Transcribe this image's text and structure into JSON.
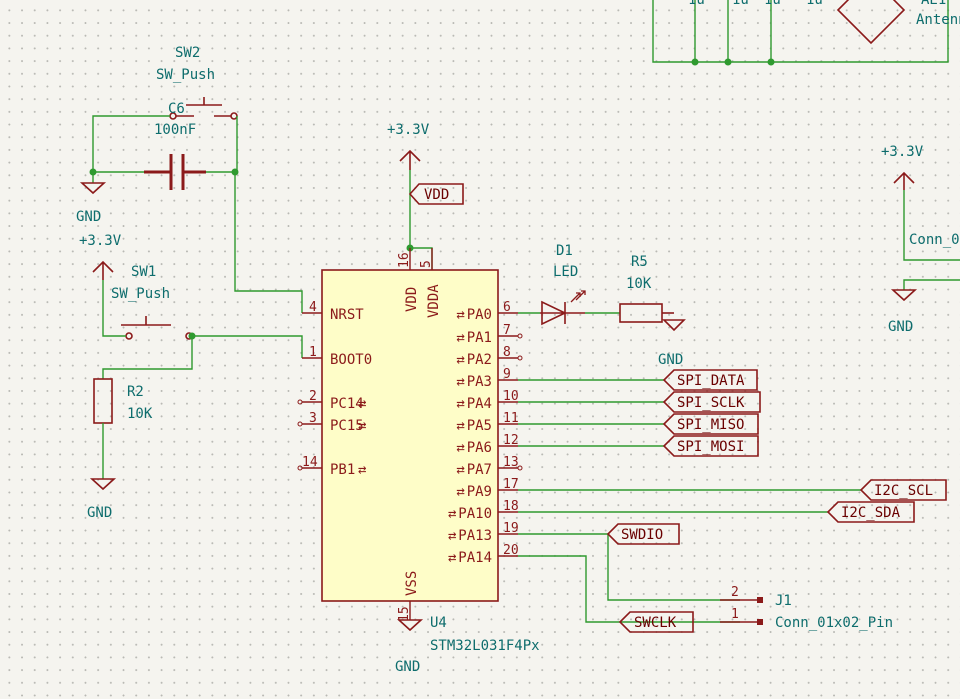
{
  "power": {
    "v33": "+3.3V",
    "gnd": "GND"
  },
  "components": {
    "sw2": {
      "ref": "SW2",
      "value": "SW_Push"
    },
    "c6": {
      "ref": "C6",
      "value": "100nF"
    },
    "sw1": {
      "ref": "SW1",
      "value": "SW_Push"
    },
    "r2": {
      "ref": "R2",
      "value": "10K"
    },
    "d1": {
      "ref": "D1",
      "value": "LED"
    },
    "r5": {
      "ref": "R5",
      "value": "10K"
    },
    "u4": {
      "ref": "U4",
      "value": "STM32L031F4Px"
    },
    "j1": {
      "ref": "J1",
      "value": "Conn_01x02_Pin"
    },
    "ae1_partial": {
      "ref": "AE1",
      "value": "Antenna"
    },
    "conn_partial": {
      "value": "Conn_0"
    }
  },
  "partial_top_labels": [
    "1u",
    "1u",
    "1u",
    "1u"
  ],
  "ic_pins_left": [
    {
      "num": "4",
      "name": "NRST"
    },
    {
      "num": "1",
      "name": "BOOT0"
    },
    {
      "num": "2",
      "name": "PC14"
    },
    {
      "num": "3",
      "name": "PC15"
    },
    {
      "num": "14",
      "name": "PB1"
    }
  ],
  "ic_pins_right": [
    {
      "num": "6",
      "name": "PA0"
    },
    {
      "num": "7",
      "name": "PA1"
    },
    {
      "num": "8",
      "name": "PA2"
    },
    {
      "num": "9",
      "name": "PA3"
    },
    {
      "num": "10",
      "name": "PA4"
    },
    {
      "num": "11",
      "name": "PA5"
    },
    {
      "num": "12",
      "name": "PA6"
    },
    {
      "num": "13",
      "name": "PA7"
    },
    {
      "num": "17",
      "name": "PA9"
    },
    {
      "num": "18",
      "name": "PA10"
    },
    {
      "num": "19",
      "name": "PA13"
    },
    {
      "num": "20",
      "name": "PA14"
    }
  ],
  "ic_pins_top": [
    {
      "num": "16",
      "name": "VDD"
    },
    {
      "num": "5",
      "name": "VDDA"
    }
  ],
  "ic_pins_bottom": [
    {
      "num": "15",
      "name": "VSS"
    }
  ],
  "net_labels": {
    "vdd": "VDD",
    "spi_data": "SPI_DATA",
    "spi_sclk": "SPI_SCLK",
    "spi_miso": "SPI_MISO",
    "spi_mosi": "SPI_MOSI",
    "i2c_scl": "I2C_SCL",
    "i2c_sda": "I2C_SDA",
    "swdio": "SWDIO",
    "swclk": "SWCLK"
  },
  "j1_pins": [
    "2",
    "1"
  ],
  "colors": {
    "wire": "#2f9a2f",
    "component": "#8b1a1a",
    "body_fill": "#fefdc8",
    "ref_text": "#0e6d6d",
    "background": "#f5f4ef"
  }
}
